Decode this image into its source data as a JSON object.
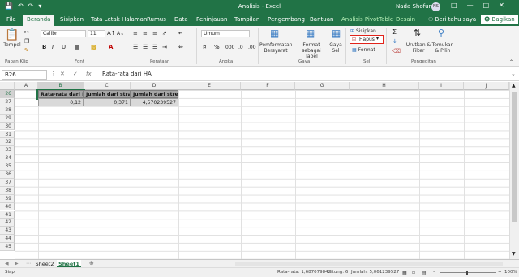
{
  "window": {
    "title": "Analisis  -  Excel",
    "user": "Nada Shofura",
    "initials": "NS"
  },
  "tabs": [
    "File",
    "Beranda",
    "Sisipkan",
    "Tata Letak Halaman",
    "Rumus",
    "Data",
    "Peninjauan",
    "Tampilan",
    "Pengembang",
    "Bantuan",
    "Analisis PivotTable",
    "Desain"
  ],
  "active_tab": "Beranda",
  "tellme": "Beri tahu saya",
  "share": "Bagikan",
  "ribbon": {
    "clipboard": {
      "label": "Papan Klip",
      "paste": "Tempel"
    },
    "font": {
      "label": "Font",
      "name": "Calibri",
      "size": "11"
    },
    "alignment": {
      "label": "Perataan"
    },
    "number": {
      "label": "Angka",
      "format": "Umum"
    },
    "styles": {
      "label": "Gaya",
      "cond": "Pemformatan Bersyarat",
      "table": "Format sebagai Tabel",
      "cell": "Gaya Sel"
    },
    "cells": {
      "label": "Sel",
      "insert": "Sisipkan",
      "delete": "Hapus",
      "format": "Format"
    },
    "editing": {
      "label": "Pengeditan",
      "sort": "Urutkan & Filter",
      "find": "Temukan & Pilih"
    }
  },
  "formula_bar": {
    "name_box": "B26",
    "value": "Rata-rata dari HA"
  },
  "columns": [
    "A",
    "B",
    "C",
    "D",
    "E",
    "F",
    "G",
    "H",
    "I",
    "J"
  ],
  "rows": [
    "26",
    "27",
    "28",
    "29",
    "30",
    "31",
    "32",
    "33",
    "34",
    "35",
    "36",
    "37",
    "38",
    "39",
    "40",
    "41",
    "42",
    "43",
    "44",
    "45"
  ],
  "cells": {
    "b26": "Rata-rata dari HA",
    "c26": "Jumlah dari strain",
    "d26": "Jumlah dari stress",
    "b27": "0,12",
    "c27": "0,371",
    "d27": "4,570239527"
  },
  "sheets": [
    "Sheet2",
    "Sheet1"
  ],
  "active_sheet": "Sheet1",
  "status": {
    "ready": "Siap",
    "average": "Rata-rata: 1,687079842",
    "count": "Hitung: 6",
    "sum": "Jumlah: 5,061239527",
    "zoom": "100%"
  },
  "colors": {
    "accent": "#217346",
    "highlight": "#e2231a"
  }
}
